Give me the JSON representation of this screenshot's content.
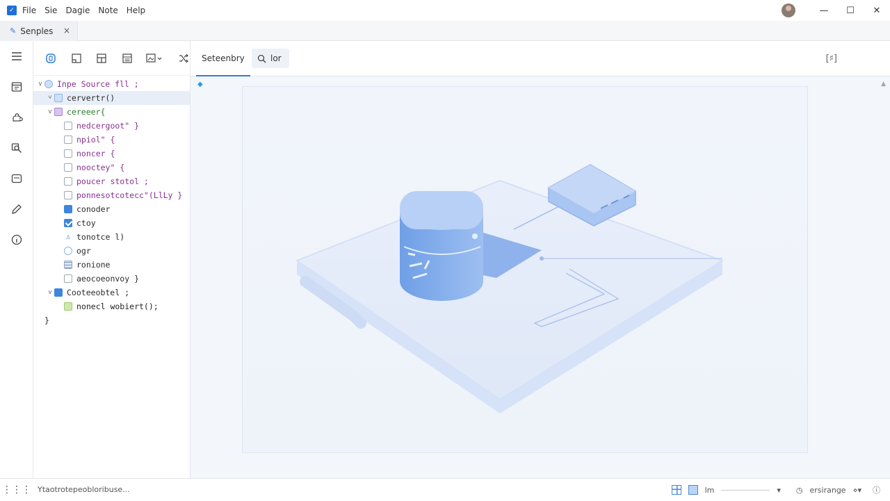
{
  "menubar": {
    "items": [
      "File",
      "Sie",
      "Dagie",
      "Note",
      "Help"
    ]
  },
  "window": {
    "minimize": "—",
    "maximize": "☐",
    "close": "✕"
  },
  "tabbar": {
    "file_tab": "Senples",
    "close": "×"
  },
  "tree": [
    {
      "chev": "v",
      "icon": "round blue",
      "text": "Inpe Source fll ;",
      "cls": "t-purple",
      "indent": 0
    },
    {
      "chev": "˅",
      "icon": "blue",
      "text": "cervertr()",
      "cls": "t-dark",
      "indent": 1,
      "sel": true
    },
    {
      "chev": "v",
      "icon": "purple",
      "text": "cereeer{",
      "cls": "t-green",
      "indent": 1
    },
    {
      "chev": "",
      "icon": "",
      "text": "nedcergoot\" }",
      "cls": "t-purple",
      "indent": 2
    },
    {
      "chev": "",
      "icon": "",
      "text": "npiol\" {",
      "cls": "t-purple",
      "indent": 2
    },
    {
      "chev": "",
      "icon": "",
      "text": "noncer {",
      "cls": "t-purple",
      "indent": 2
    },
    {
      "chev": "",
      "icon": "",
      "text": "nooctey\" {",
      "cls": "t-purple",
      "indent": 2
    },
    {
      "chev": "",
      "icon": "",
      "text": "poucer stotol ;",
      "cls": "t-purple",
      "indent": 2
    },
    {
      "chev": "",
      "icon": "",
      "text": "ponnesotcotecc\"(LlLy }",
      "cls": "t-purple",
      "indent": 2
    },
    {
      "chev": "",
      "icon": "solid",
      "text": "conoder",
      "cls": "t-dark",
      "indent": 2
    },
    {
      "chev": "",
      "icon": "check",
      "text": "ctoy",
      "cls": "t-dark",
      "indent": 2
    },
    {
      "chev": "",
      "icon": "person",
      "text": "tonotce l)",
      "cls": "t-dark",
      "indent": 2
    },
    {
      "chev": "",
      "icon": "round",
      "text": "ogr",
      "cls": "t-dark",
      "indent": 2
    },
    {
      "chev": "",
      "icon": "grid",
      "text": "ronione",
      "cls": "t-dark",
      "indent": 2
    },
    {
      "chev": "",
      "icon": "",
      "text": "aeocoeonvoy }",
      "cls": "t-dark",
      "indent": 2
    },
    {
      "chev": "v",
      "icon": "solid",
      "text": "Cooteeobtel ;",
      "cls": "t-dark",
      "indent": 1
    },
    {
      "chev": "",
      "icon": "green",
      "text": "nonecl wobiert();",
      "cls": "t-mixed",
      "indent": 2
    },
    {
      "chev": "",
      "icon": "",
      "text": "}",
      "cls": "t-dark",
      "indent": 0
    }
  ],
  "editor": {
    "tab_label": "Seteenbry",
    "search_label": "lor",
    "expand_icon": "[♯]"
  },
  "statusbar": {
    "text": "Ytaotrotepeobloribuse...",
    "zoom_label": "lm",
    "status_item": "ersirange"
  },
  "colors": {
    "accent": "#2f7ad8",
    "illustration_blue": "#7fa8e8",
    "canvas_bg": "#f3f6fb"
  }
}
